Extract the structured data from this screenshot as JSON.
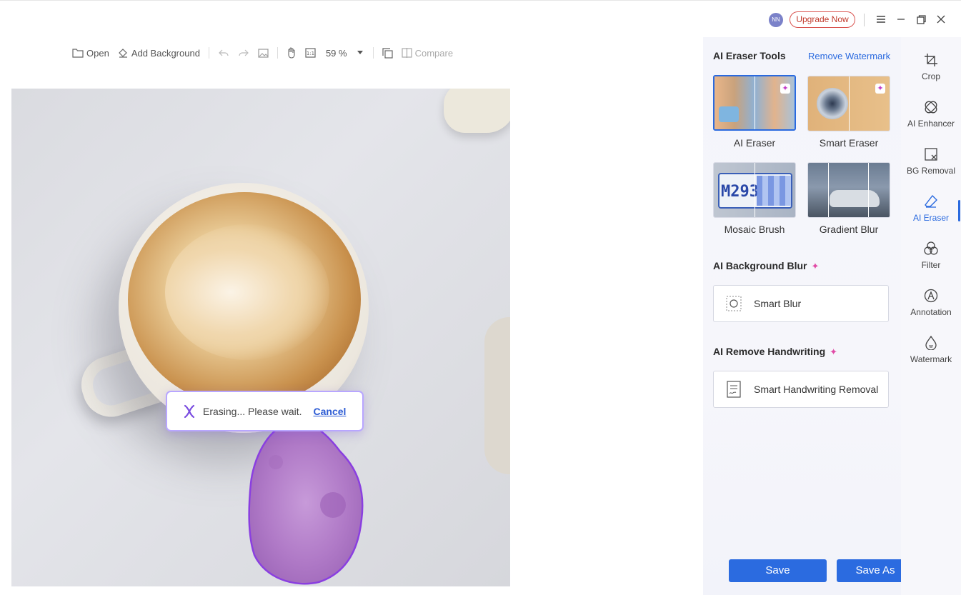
{
  "titlebar": {
    "avatar_initials": "NN",
    "upgrade_label": "Upgrade Now",
    "icons": [
      "menu-icon",
      "minimize-icon",
      "restore-icon",
      "close-icon"
    ]
  },
  "toolbar": {
    "open_label": "Open",
    "add_background_label": "Add Background",
    "zoom_value": "59 %",
    "compare_label": "Compare"
  },
  "canvas": {
    "toast_text": "Erasing... Please wait.",
    "toast_cancel": "Cancel"
  },
  "panel": {
    "eraser_tools_title": "AI Eraser Tools",
    "remove_watermark_link": "Remove Watermark",
    "tools": [
      {
        "label": "AI Eraser",
        "selected": true
      },
      {
        "label": "Smart Eraser",
        "selected": false
      },
      {
        "label": "Mosaic Brush",
        "selected": false
      },
      {
        "label": "Gradient Blur",
        "selected": false
      }
    ],
    "bg_blur_title": "AI Background Blur",
    "smart_blur_label": "Smart Blur",
    "handwriting_title": "AI Remove Handwriting",
    "handwriting_btn_label": "Smart Handwriting Removal",
    "save_label": "Save",
    "save_as_label": "Save As"
  },
  "rail": {
    "items": [
      {
        "label": "Crop",
        "icon": "crop-icon"
      },
      {
        "label": "AI Enhancer",
        "icon": "enhancer-icon"
      },
      {
        "label": "BG Removal",
        "icon": "bg-removal-icon"
      },
      {
        "label": "AI Eraser",
        "icon": "eraser-icon",
        "active": true
      },
      {
        "label": "Filter",
        "icon": "filter-icon"
      },
      {
        "label": "Annotation",
        "icon": "annotation-icon"
      },
      {
        "label": "Watermark",
        "icon": "watermark-icon"
      }
    ]
  },
  "colors": {
    "accent": "#2b6be0",
    "upgrade": "#c0392b",
    "mask": "#a56bd6"
  }
}
